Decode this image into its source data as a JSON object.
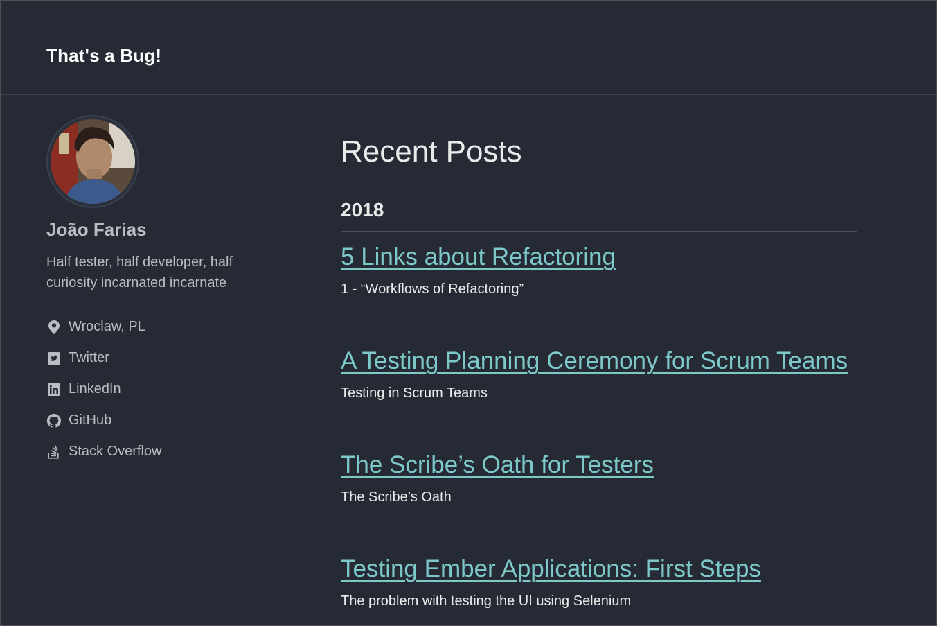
{
  "site": {
    "title": "That's a Bug!"
  },
  "author": {
    "name": "João Farias",
    "bio": "Half tester, half developer, half curiosity incarnated incarnate",
    "links": [
      {
        "icon": "location-icon",
        "label": "Wroclaw, PL"
      },
      {
        "icon": "twitter-icon",
        "label": "Twitter"
      },
      {
        "icon": "linkedin-icon",
        "label": "LinkedIn"
      },
      {
        "icon": "github-icon",
        "label": "GitHub"
      },
      {
        "icon": "stack-overflow-icon",
        "label": "Stack Overflow"
      }
    ]
  },
  "main": {
    "heading": "Recent Posts",
    "year": "2018",
    "posts": [
      {
        "title": "5 Links about Refactoring",
        "excerpt": "1 - “Workflows of Refactoring”"
      },
      {
        "title": "A Testing Planning Ceremony for Scrum Teams",
        "excerpt": "Testing in Scrum Teams"
      },
      {
        "title": "The Scribe’s Oath for Testers",
        "excerpt": "The Scribe’s Oath"
      },
      {
        "title": "Testing Ember Applications: First Steps",
        "excerpt": "The problem with testing the UI using Selenium"
      }
    ]
  },
  "colors": {
    "background": "#252a34",
    "link": "#7dc9c9",
    "muted_text": "#b9bcc2"
  }
}
